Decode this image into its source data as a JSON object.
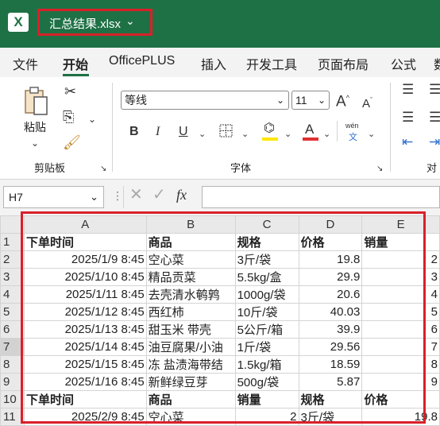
{
  "app": {
    "title": "汇总结果.xlsx"
  },
  "tabs": [
    "文件",
    "开始",
    "OfficePLUS",
    "插入",
    "开发工具",
    "页面布局",
    "公式",
    "数"
  ],
  "active_tab": "开始",
  "ribbon": {
    "clipboard": {
      "paste_label": "粘贴",
      "group_label": "剪贴板"
    },
    "font": {
      "font_name": "等线",
      "font_size": "11",
      "bold": "B",
      "italic": "I",
      "underline": "U",
      "font_color_glyph": "A",
      "phonetic_top": "wén",
      "phonetic_bottom": "文",
      "group_label": "字体",
      "grow_glyph": "A",
      "shrink_glyph": "A"
    },
    "alignment": {
      "group_label": "对"
    }
  },
  "formula_bar": {
    "cell_ref": "H7",
    "fx_label": "fx",
    "value": ""
  },
  "colors": {
    "brand": "#1e7145",
    "highlight": "#d9202a",
    "font_color_bar": "#e03030",
    "fill_color_bar": "#ffe600"
  },
  "sheet": {
    "columns": [
      "A",
      "B",
      "C",
      "D",
      "E"
    ],
    "rows": [
      {
        "n": "1",
        "cells": [
          "下单时间",
          "商品",
          "规格",
          "价格",
          "销量"
        ]
      },
      {
        "n": "2",
        "cells": [
          "2025/1/9 8:45",
          "空心菜",
          "3斤/袋",
          "19.8",
          "2"
        ]
      },
      {
        "n": "3",
        "cells": [
          "2025/1/10 8:45",
          "精品贡菜",
          "5.5kg/盒",
          "29.9",
          "3"
        ]
      },
      {
        "n": "4",
        "cells": [
          "2025/1/11 8:45",
          "去壳清水鹌鹑",
          "1000g/袋",
          "20.6",
          "4"
        ]
      },
      {
        "n": "5",
        "cells": [
          "2025/1/12 8:45",
          "西红柿",
          "10斤/袋",
          "40.03",
          "5"
        ]
      },
      {
        "n": "6",
        "cells": [
          "2025/1/13 8:45",
          "甜玉米 带壳",
          "5公斤/箱",
          "39.9",
          "6"
        ]
      },
      {
        "n": "7",
        "cells": [
          "2025/1/14 8:45",
          "油豆腐果/小油",
          "1斤/袋",
          "29.56",
          "7"
        ]
      },
      {
        "n": "8",
        "cells": [
          "2025/1/15 8:45",
          "冻 盐渍海带结",
          "1.5kg/箱",
          "18.59",
          "8"
        ]
      },
      {
        "n": "9",
        "cells": [
          "2025/1/16 8:45",
          "新鲜绿豆芽",
          "500g/袋",
          "5.87",
          "9"
        ]
      },
      {
        "n": "10",
        "cells": [
          "下单时间",
          "商品",
          "销量",
          "规格",
          "价格"
        ]
      },
      {
        "n": "11",
        "cells": [
          "2025/2/9 8:45",
          "空心菜",
          "2",
          "3斤/袋",
          "19.8"
        ]
      }
    ]
  }
}
